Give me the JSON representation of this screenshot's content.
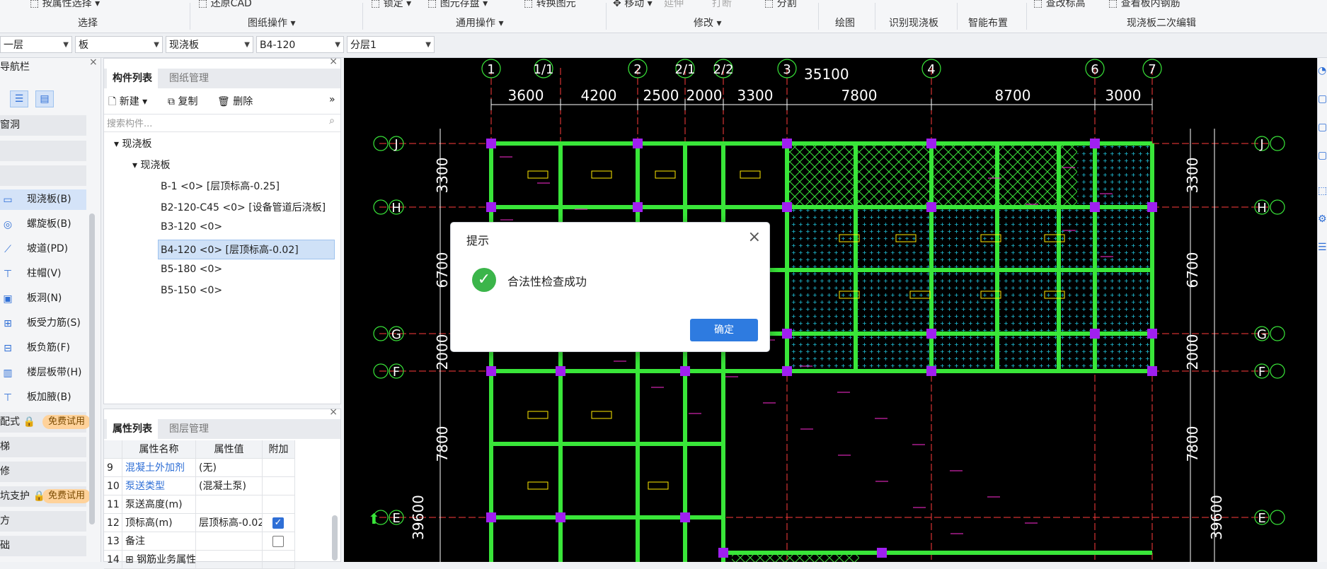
{
  "ribbon": {
    "top_labels": [
      "按属性选择",
      "还原CAD",
      "锁定",
      "图元存盘",
      "转换图元",
      "移动",
      "延伸",
      "打断",
      "分割"
    ],
    "groups": [
      "选择",
      "图纸操作",
      "通用操作",
      "修改",
      "绘图",
      "识别现浇板",
      "智能布置",
      "现浇板二次编辑"
    ],
    "right_labels": [
      "查改标高",
      "查看板内钢筋"
    ]
  },
  "filters": {
    "floor": "一层",
    "category": "板",
    "type": "现浇板",
    "item": "B4-120",
    "layer": "分层1"
  },
  "nav": {
    "title": "导航栏",
    "band1": "窗洞",
    "items": [
      "现浇板(B)",
      "螺旋板(B)",
      "坡道(PD)",
      "柱帽(V)",
      "板洞(N)",
      "板受力筋(S)",
      "板负筋(F)",
      "楼层板带(H)",
      "板加腋(B)"
    ],
    "section_labels": [
      "配式",
      "梯",
      "修",
      "坑支护",
      "方",
      "础"
    ],
    "badge": "免费试用"
  },
  "component_panel": {
    "tab_active": "构件列表",
    "tab_inactive": "图纸管理",
    "btn_new": "新建",
    "btn_copy": "复制",
    "btn_delete": "删除",
    "search_placeholder": "搜索构件...",
    "tree_root": "现浇板",
    "tree_child": "现浇板",
    "items": [
      "B-1 <0> [层顶标高-0.25]",
      "B2-120-C45 <0> [设备管道后浇板]",
      "B3-120 <0>",
      "B4-120 <0> [层顶标高-0.02]",
      "B5-180 <0>",
      "B5-150 <0>"
    ]
  },
  "property_panel": {
    "tab_active": "属性列表",
    "tab_inactive": "图层管理",
    "headers": [
      "属性名称",
      "属性值",
      "附加"
    ],
    "rows": [
      {
        "no": "9",
        "name": "混凝土外加剂",
        "value": "(无)",
        "link": true,
        "check": null
      },
      {
        "no": "10",
        "name": "泵送类型",
        "value": "(混凝土泵)",
        "link": true,
        "check": null
      },
      {
        "no": "11",
        "name": "泵送高度(m)",
        "value": "",
        "link": false,
        "check": null
      },
      {
        "no": "12",
        "name": "顶标高(m)",
        "value": "层顶标高-0.02",
        "link": false,
        "check": true
      },
      {
        "no": "13",
        "name": "备注",
        "value": "",
        "link": false,
        "check": false
      },
      {
        "no": "14",
        "name": "钢筋业务属性",
        "value": "",
        "link": false,
        "check": null
      }
    ]
  },
  "cad": {
    "top_axes": [
      "1",
      "1/1",
      "2",
      "2/1",
      "2/2",
      "3",
      "4",
      "6",
      "7"
    ],
    "total_dim": "35100",
    "spans": [
      "3600",
      "4200",
      "2500",
      "2000",
      "3300",
      "7800",
      "8700",
      "3000"
    ],
    "row_axes": [
      "J",
      "H",
      "G",
      "F",
      "E"
    ],
    "left_dims": [
      "3300",
      "6700",
      "2000",
      "7800"
    ],
    "left_total": "39600",
    "right_dims": [
      "3300",
      "6700",
      "2000",
      "7800"
    ],
    "right_total": "39600",
    "colors": {
      "beam": "#39e639",
      "axis": "#ff3b3b",
      "dim": "#ffffff",
      "col": "#a020f0",
      "hatch": "#22d3ee"
    }
  },
  "dialog": {
    "title": "提示",
    "message": "合法性检查成功",
    "ok": "确定"
  }
}
